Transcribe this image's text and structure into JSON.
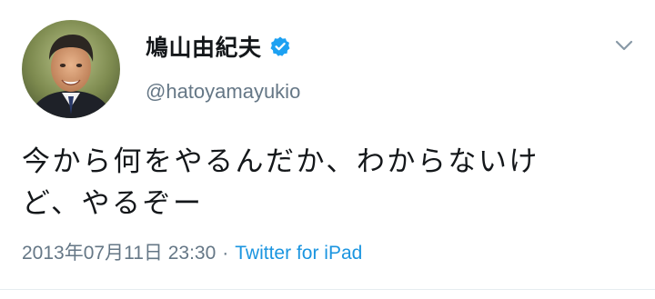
{
  "user": {
    "display_name": "鳩山由紀夫",
    "handle": "@hatoyamayukio",
    "verified": true
  },
  "tweet": {
    "text_line1": "今から何をやるんだか、わからないけ",
    "text_line2": "ど、やるぞー",
    "timestamp": "2013年07月11日 23:30",
    "separator": "·",
    "source": "Twitter for iPad"
  },
  "icons": {
    "verified": "verified-badge-icon",
    "menu": "chevron-down-icon"
  },
  "colors": {
    "verified_blue": "#1da1f2",
    "link_blue": "#1b95e0",
    "secondary_text": "#657786",
    "primary_text": "#14171a"
  }
}
